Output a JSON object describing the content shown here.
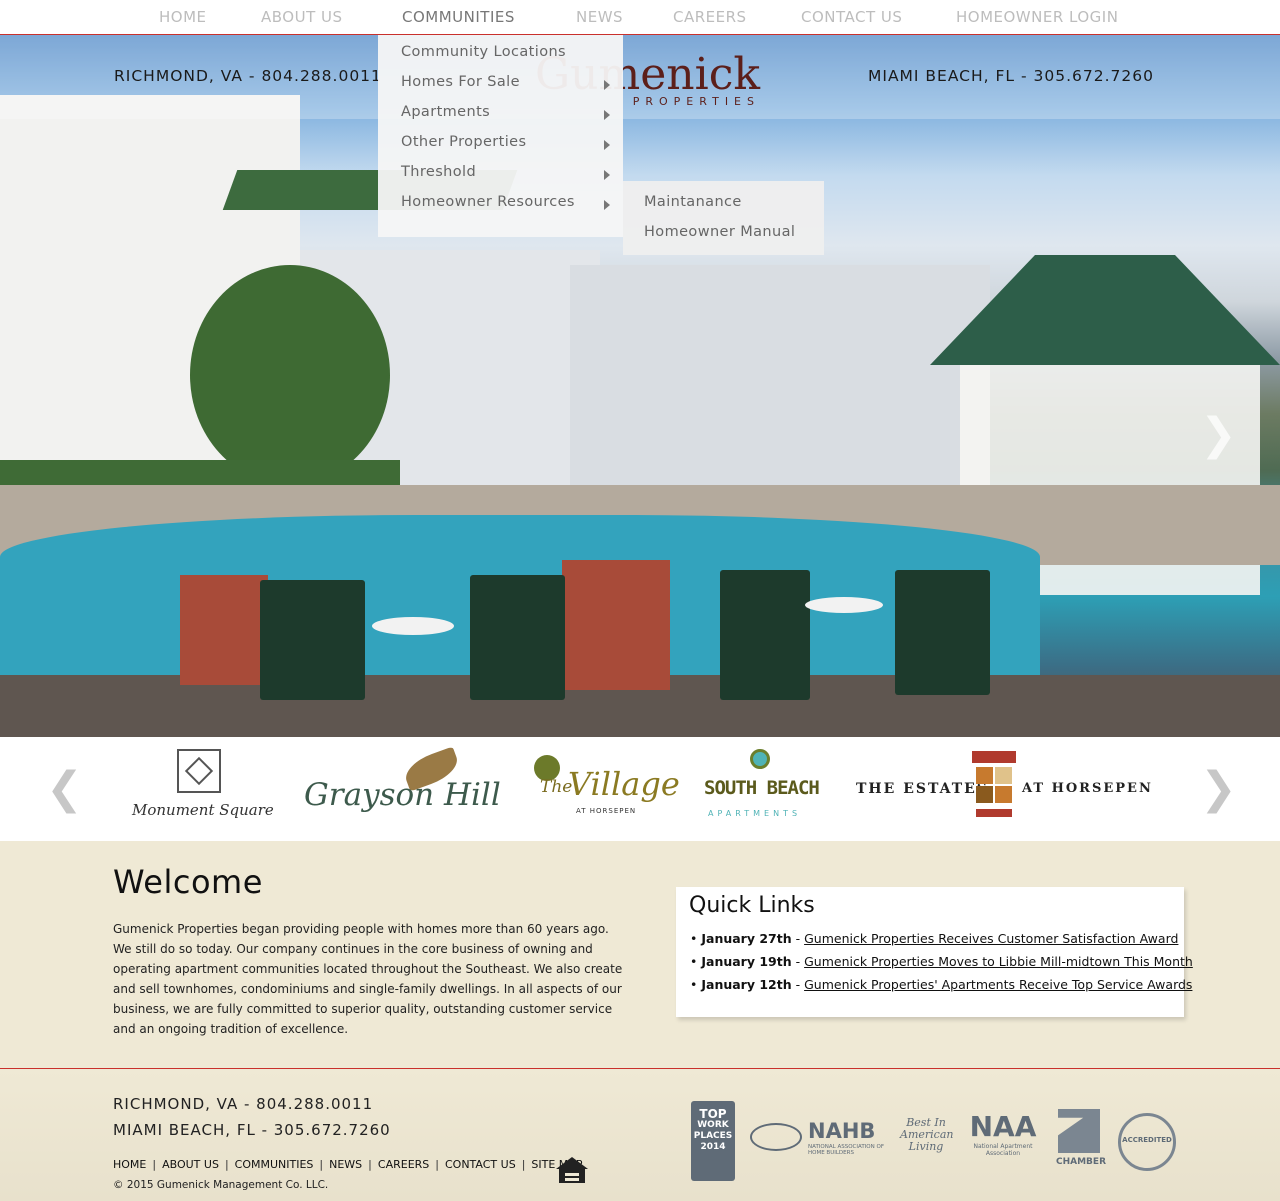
{
  "nav": {
    "home": "HOME",
    "about": "ABOUT US",
    "communities": "COMMUNITIES",
    "news": "NEWS",
    "careers": "CAREERS",
    "contact": "CONTACT US",
    "homeowner_login": "HOMEOWNER LOGIN"
  },
  "dropdown": {
    "community_locations": "Community Locations",
    "homes_for_sale": "Homes For Sale",
    "apartments": "Apartments",
    "other_properties": "Other Properties",
    "threshold": "Threshold",
    "homeowner_resources": "Homeowner Resources"
  },
  "submenu": {
    "maintanance": "Maintanance",
    "homeowner_manual": "Homeowner Manual"
  },
  "hero": {
    "phone_left": "RICHMOND, VA - 804.288.0011",
    "phone_right": "MIAMI BEACH, FL - 305.672.7260",
    "logo_brand": "Gumenick",
    "logo_sub": "PROPERTIES",
    "next_icon": "chevron-right-icon"
  },
  "communities": {
    "monument_square": "Monument Square",
    "grayson_hill": "Grayson Hill",
    "village_the": "The",
    "village_name": "Village",
    "village_sub": "AT HORSEPEN",
    "south_beach": "SOUTH BEACH",
    "south_beach_sub": "APARTMENTS",
    "estates_left": "THE ESTATES",
    "estates_right": "AT HORSEPEN"
  },
  "welcome": {
    "title": "Welcome",
    "body": "Gumenick Properties began providing people with homes more than 60 years ago. We still do so today. Our company continues in the core business of owning and operating apartment communities located throughout the Southeast. We also create and sell townhomes, condominiums and single-family dwellings. In all aspects of our business, we are fully committed to superior quality, outstanding customer service and an ongoing tradition of excellence."
  },
  "quick_links": {
    "title": "Quick Links",
    "items": [
      {
        "date": "January 27th",
        "text": "Gumenick Properties Receives Customer Satisfaction Award"
      },
      {
        "date": "January 19th",
        "text": "Gumenick Properties Moves to Libbie Mill-midtown This Month"
      },
      {
        "date": "January 12th",
        "text": "Gumenick Properties' Apartments Receive Top Service Awards"
      }
    ]
  },
  "footer": {
    "phone_richmond": "RICHMOND, VA - 804.288.0011",
    "phone_miami": "MIAMI BEACH, FL - 305.672.7260",
    "links": {
      "home": "HOME",
      "about": "ABOUT US",
      "communities": "COMMUNITIES",
      "news": "NEWS",
      "careers": "CAREERS",
      "contact": "CONTACT US",
      "sitemap": "SITE MAP"
    },
    "copyright": "© 2015 Gumenick Management Co. LLC.",
    "badges": {
      "top_work_1": "TOP",
      "top_work_2": "WORK",
      "top_work_3": "PLACES",
      "top_work_4": "2014",
      "nahb": "NAHB",
      "nahb_sub": "NATIONAL ASSOCIATION OF HOME BUILDERS",
      "best_1": "Best In",
      "best_2": "American",
      "best_3": "Living",
      "naa": "NAA",
      "naa_sub": "National Apartment Association",
      "chamber": "CHAMBER",
      "accredited": "ACCREDITED"
    }
  },
  "colors": {
    "accent_red": "#c9302c",
    "beige": "#efe9d5",
    "nav_gray": "#bdbdbd"
  }
}
